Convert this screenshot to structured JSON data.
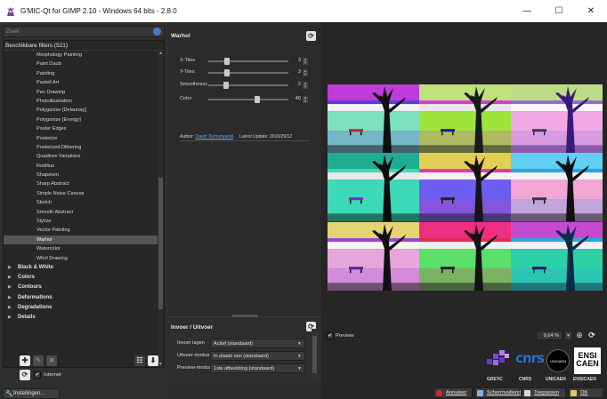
{
  "window": {
    "title": "G'MIC-Qt for GIMP 2.10 - Windows 64 bits - 2.8.0",
    "controls": [
      "—",
      "☐",
      "✕"
    ]
  },
  "left": {
    "search_placeholder": "Zoek",
    "tree_header": "Beschikbare filters (521)",
    "filters": [
      "Morphology Painting",
      "Paint Daub",
      "Painting",
      "Pastell Art",
      "Pen Drawing",
      "Photoillustration",
      "Polygonize [Delaunay]",
      "Polygonize [Energy]",
      "Poster Edges",
      "Posterize",
      "Posterized Dithering",
      "Quadtree Variations",
      "Rodilius",
      "Shapeism",
      "Sharp Abstract",
      "Simple Noise Canvas",
      "Sketch",
      "Smooth Abstract",
      "Stylize",
      "Vector Painting",
      "Warhol",
      "Watercolor",
      "Whirl Drawing"
    ],
    "selected_filter": "Warhol",
    "categories": [
      "Black & White",
      "Colors",
      "Contours",
      "Deformations",
      "Degradations",
      "Details"
    ],
    "internet_label": "Internet",
    "internet_checked": true,
    "settings_label": "Instellingen..."
  },
  "filter": {
    "title": "Warhol",
    "params": [
      {
        "label": "X-Tiles",
        "value": "3",
        "fraction": 0.22
      },
      {
        "label": "Y-Tiles",
        "value": "3",
        "fraction": 0.22
      },
      {
        "label": "Smoothness",
        "value": "2",
        "fraction": 0.2
      },
      {
        "label": "Color",
        "value": "40",
        "fraction": 0.62
      }
    ],
    "author_label": "Author:",
    "author_name": "David Tschumperlé",
    "update_label": "Latest Update: 2010/29/12"
  },
  "io": {
    "title": "Invoer / Uitvoer",
    "rows": [
      {
        "label": "Invoer lagen",
        "value": "Actief (standaard)"
      },
      {
        "label": "Uitvoer-modus",
        "value": "In plaats van (standaard)"
      },
      {
        "label": "Preview-modus",
        "value": "1ste afbeelding (standaard)"
      }
    ]
  },
  "preview": {
    "checkbox_label": "Preview",
    "checked": true,
    "zoom": "9,64 %"
  },
  "logos": {
    "labels": [
      "GREYC",
      "CNRS",
      "UNICAEN",
      "ENSICAEN"
    ],
    "cnrs_text": "cnrs",
    "unicaen_text": "UNICAEN",
    "ensi_lines": [
      "ENSI",
      "CAEN"
    ]
  },
  "buttons": {
    "cancel": "Annuleer",
    "fullscreen": "Schermvullend",
    "apply": "Toepassen",
    "ok": "OK"
  },
  "colors": {
    "accent_blue": "#3d7fc9",
    "cancel_red": "#e02424"
  },
  "tiles": [
    {
      "sky": "#5e3fd6",
      "ground": "#7de0c0",
      "tree": "#101010",
      "foliage": "#d03cd8",
      "horizon": "#f2f2f2",
      "bench": "#c02424"
    },
    {
      "sky": "#d93ad0",
      "ground": "#9de53a",
      "tree": "#1a1a1a",
      "foliage": "#b8ff6a",
      "horizon": "#e8e8e8",
      "bench": "#1b1b8a"
    },
    {
      "sky": "#8f6fd0",
      "ground": "#f1a9e6",
      "tree": "#3b1a78",
      "foliage": "#c7f07a",
      "horizon": "#fafafa",
      "bench": "#3c3c3c"
    },
    {
      "sky": "#3ed9b8",
      "ground": "#3ed9b8",
      "tree": "#0d0d0d",
      "foliage": "#1aa58a",
      "horizon": "#e8e8e8",
      "bench": "#7a2ad0"
    },
    {
      "sky": "#d83fa8",
      "ground": "#6a5ef0",
      "tree": "#151515",
      "foliage": "#e8e848",
      "horizon": "#f0f0f0",
      "bench": "#222"
    },
    {
      "sky": "#2d9fe8",
      "ground": "#f3a6d6",
      "tree": "#0f0f0f",
      "foliage": "#6ad7f5",
      "horizon": "#f4f4f4",
      "bench": "#3a3a3a"
    },
    {
      "sky": "#9a42d6",
      "ground": "#e6a6d9",
      "tree": "#101010",
      "foliage": "#f0f060",
      "horizon": "#f5f5f5",
      "bench": "#4a2a9a"
    },
    {
      "sky": "#e22a54",
      "ground": "#5ae06a",
      "tree": "#131313",
      "foliage": "#f02f8a",
      "horizon": "#f0f0f0",
      "bench": "#222"
    },
    {
      "sky": "#29a9d8",
      "ground": "#2dd1a6",
      "tree": "#0d2a4a",
      "foliage": "#e03ad0",
      "horizon": "#f2f2f2",
      "bench": "#202070"
    }
  ]
}
